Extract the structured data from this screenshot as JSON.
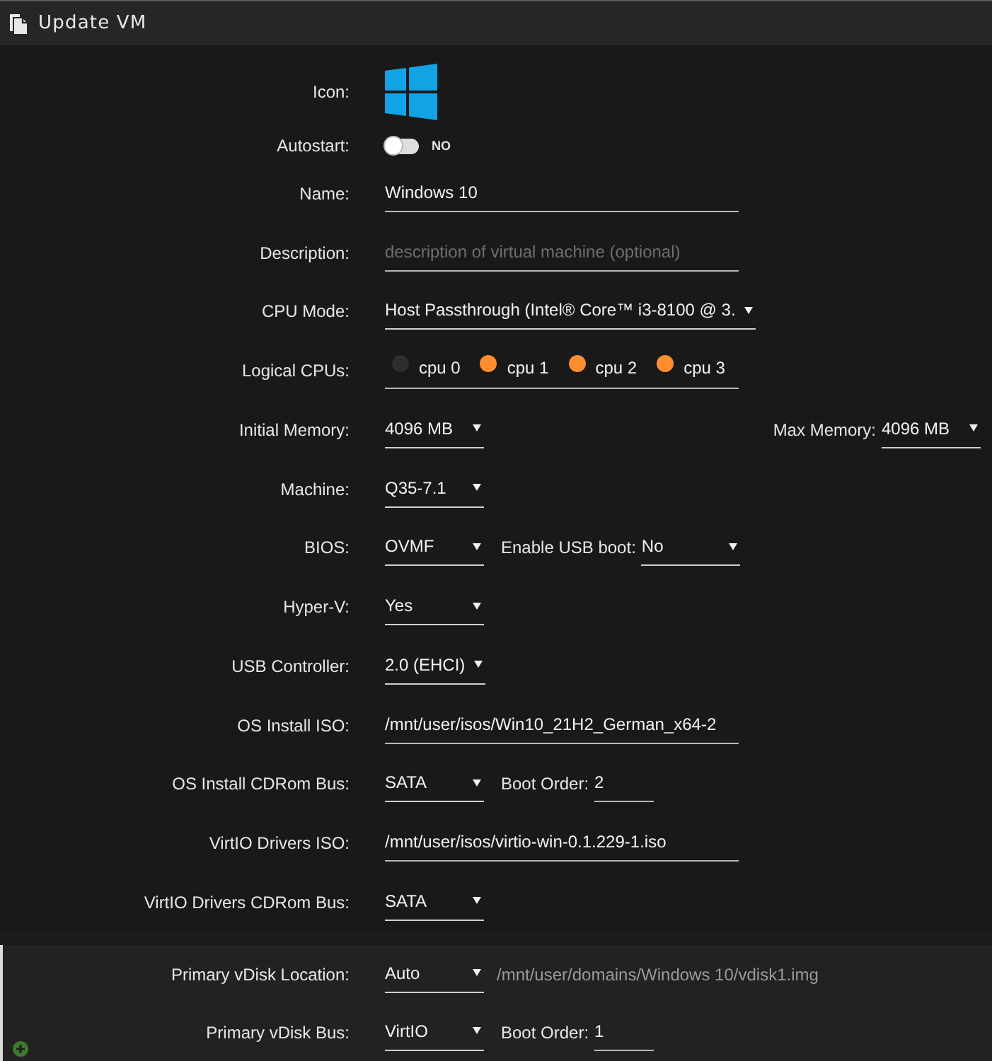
{
  "window": {
    "title": "Update VM"
  },
  "sections": [
    {
      "kind": "general",
      "rows": [
        {
          "label": "Icon:",
          "controls": [
            {
              "kind": "icon"
            }
          ]
        },
        {
          "label": "Autostart:",
          "controls": [
            {
              "kind": "toggle",
              "on": false,
              "text": "NO"
            }
          ]
        },
        {
          "label": "Name:",
          "controls": [
            {
              "kind": "text",
              "value": "Windows 10"
            }
          ]
        },
        {
          "label": "Description:",
          "controls": [
            {
              "kind": "text",
              "placeholder": "description of virtual machine (optional)"
            }
          ]
        },
        {
          "label": "CPU Mode:",
          "controls": [
            {
              "kind": "select",
              "value": "Host Passthrough (Intel® Core™ i3-8100 @ 3."
            }
          ]
        },
        {
          "label": "Logical CPUs:",
          "controls": [
            {
              "kind": "checkboxes",
              "items": [
                {
                  "label": "cpu 0",
                  "checked": false
                },
                {
                  "label": "cpu 1",
                  "checked": true
                },
                {
                  "label": "cpu 2",
                  "checked": true
                },
                {
                  "label": "cpu 3",
                  "checked": true
                }
              ]
            }
          ]
        },
        {
          "label": "Initial Memory:",
          "controls": [
            {
              "kind": "select",
              "value": "4096 MB"
            }
          ],
          "aside": [
            {
              "kind": "label",
              "text": "Max Memory:"
            },
            {
              "kind": "select",
              "value": "4096 MB"
            }
          ]
        },
        {
          "label": "Machine:",
          "controls": [
            {
              "kind": "select",
              "value": "Q35-7.1"
            }
          ]
        },
        {
          "label": "BIOS:",
          "controls": [
            {
              "kind": "select",
              "value": "OVMF"
            },
            {
              "kind": "label",
              "text": "Enable USB boot:"
            },
            {
              "kind": "select",
              "value": "No"
            }
          ]
        },
        {
          "label": "Hyper-V:",
          "controls": [
            {
              "kind": "select",
              "value": "Yes"
            }
          ]
        },
        {
          "label": "USB Controller:",
          "controls": [
            {
              "kind": "select",
              "value": "2.0 (EHCI)"
            }
          ]
        },
        {
          "label": "OS Install ISO:",
          "controls": [
            {
              "kind": "text",
              "value": "/mnt/user/isos/Win10_21H2_German_x64-2"
            }
          ]
        },
        {
          "label": "OS Install CDRom Bus:",
          "controls": [
            {
              "kind": "select",
              "value": "SATA"
            },
            {
              "kind": "label",
              "text": "Boot Order:"
            },
            {
              "kind": "number",
              "value": "2"
            }
          ]
        },
        {
          "label": "VirtIO Drivers ISO:",
          "controls": [
            {
              "kind": "text",
              "value": "/mnt/user/isos/virtio-win-0.1.229-1.iso"
            }
          ]
        },
        {
          "label": "VirtIO Drivers CDRom Bus:",
          "controls": [
            {
              "kind": "select",
              "value": "SATA"
            }
          ]
        }
      ]
    },
    {
      "kind": "disk",
      "rows": [
        {
          "label": "Primary vDisk Location:",
          "controls": [
            {
              "kind": "select",
              "value": "Auto"
            },
            {
              "kind": "note",
              "text": "/mnt/user/domains/Windows 10/vdisk1.img"
            }
          ]
        },
        {
          "label": "Primary vDisk Bus:",
          "controls": [
            {
              "kind": "select",
              "value": "VirtIO"
            },
            {
              "kind": "label",
              "text": "Boot Order:"
            },
            {
              "kind": "number",
              "value": "1"
            }
          ]
        }
      ]
    }
  ]
}
